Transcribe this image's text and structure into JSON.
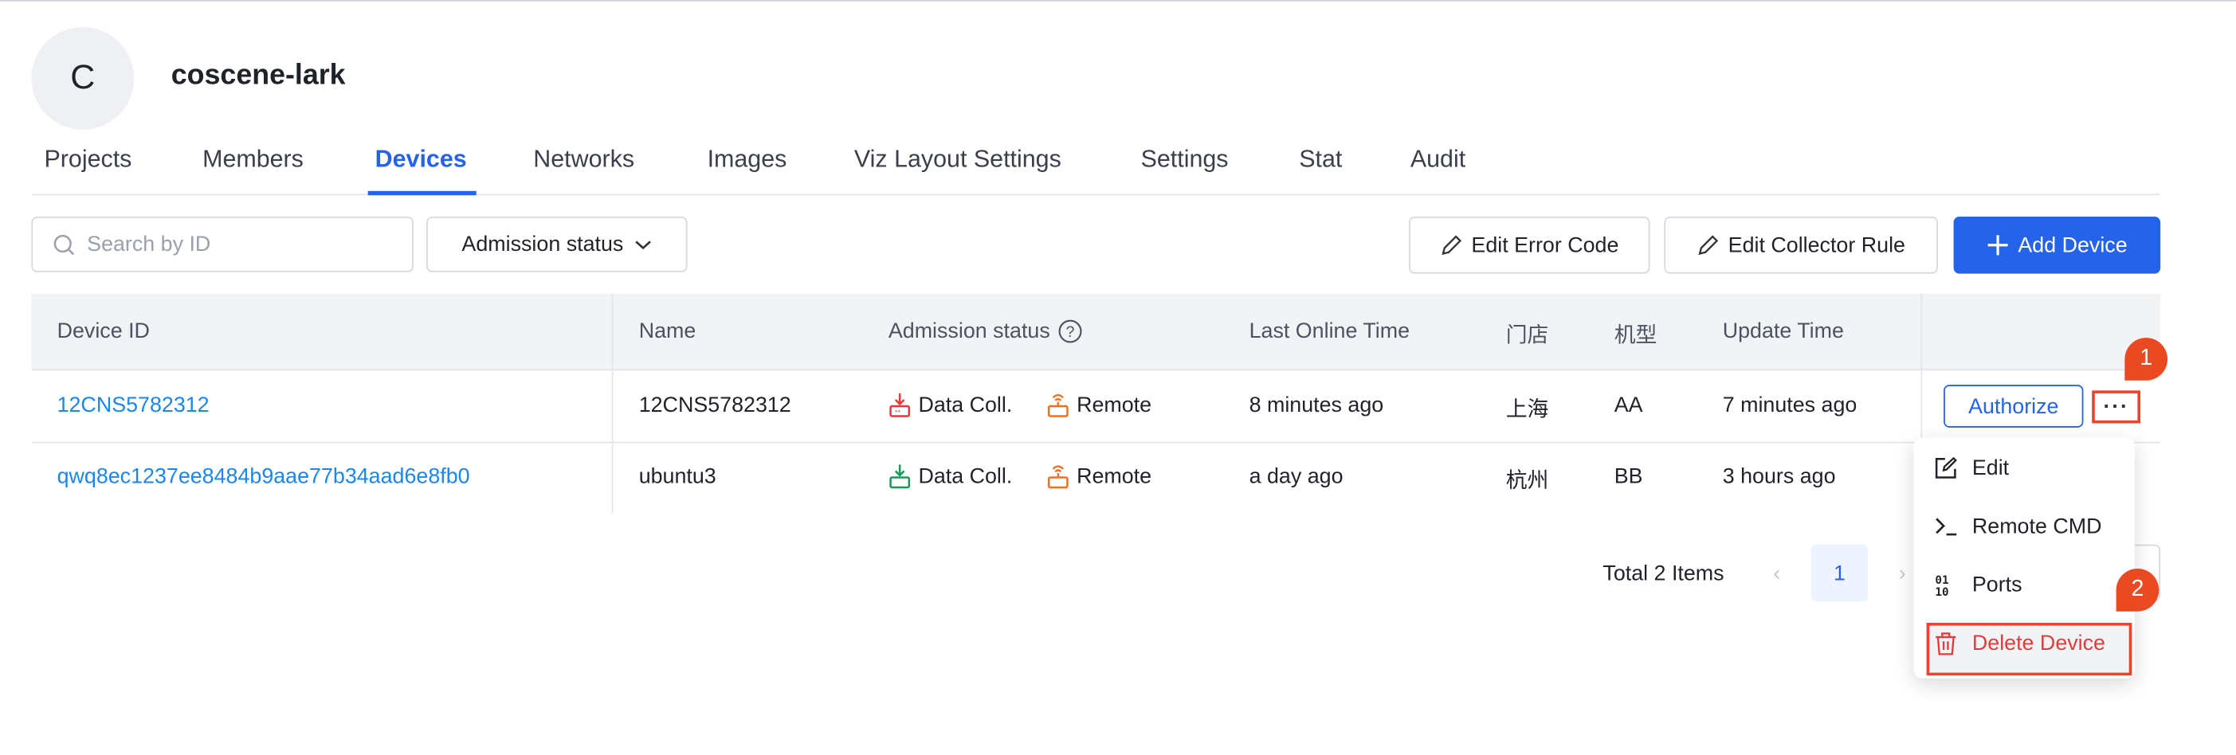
{
  "org": {
    "avatar_letter": "C",
    "name": "coscene-lark"
  },
  "tabs": [
    "Projects",
    "Members",
    "Devices",
    "Networks",
    "Images",
    "Viz Layout Settings",
    "Settings",
    "Stat",
    "Audit"
  ],
  "active_tab": "Devices",
  "toolbar": {
    "search_placeholder": "Search by ID",
    "admission_filter": "Admission status",
    "edit_error_code": "Edit Error Code",
    "edit_collector_rule": "Edit Collector Rule",
    "add_device": "Add Device"
  },
  "table": {
    "headers": [
      "Device ID",
      "Name",
      "Admission status",
      "Last Online Time",
      "门店",
      "机型",
      "Update Time"
    ],
    "rows": [
      {
        "device_id": "12CNS5782312",
        "name": "12CNS5782312",
        "data_coll": "Data Coll.",
        "data_coll_color": "#e23b3b",
        "remote": "Remote",
        "last_online": "8 minutes ago",
        "store": "上海",
        "model": "AA",
        "update_time": "7 minutes ago",
        "action": "Authorize"
      },
      {
        "device_id": "qwq8ec1237ee8484b9aae77b34aad6e8fb0",
        "name": "ubuntu3",
        "data_coll": "Data Coll.",
        "data_coll_color": "#1a9a5a",
        "remote": "Remote",
        "last_online": "a day ago",
        "store": "杭州",
        "model": "BB",
        "update_time": "3 hours ago"
      }
    ]
  },
  "pagination": {
    "total": "Total 2 Items",
    "current_page": "1"
  },
  "menu": {
    "items": [
      "Edit",
      "Remote CMD",
      "Ports",
      "Delete Device"
    ]
  },
  "annotations": {
    "step1": "1",
    "step2": "2"
  },
  "colors": {
    "accent": "#2563eb",
    "annotation": "#e8452c",
    "remote": "#f07020"
  }
}
